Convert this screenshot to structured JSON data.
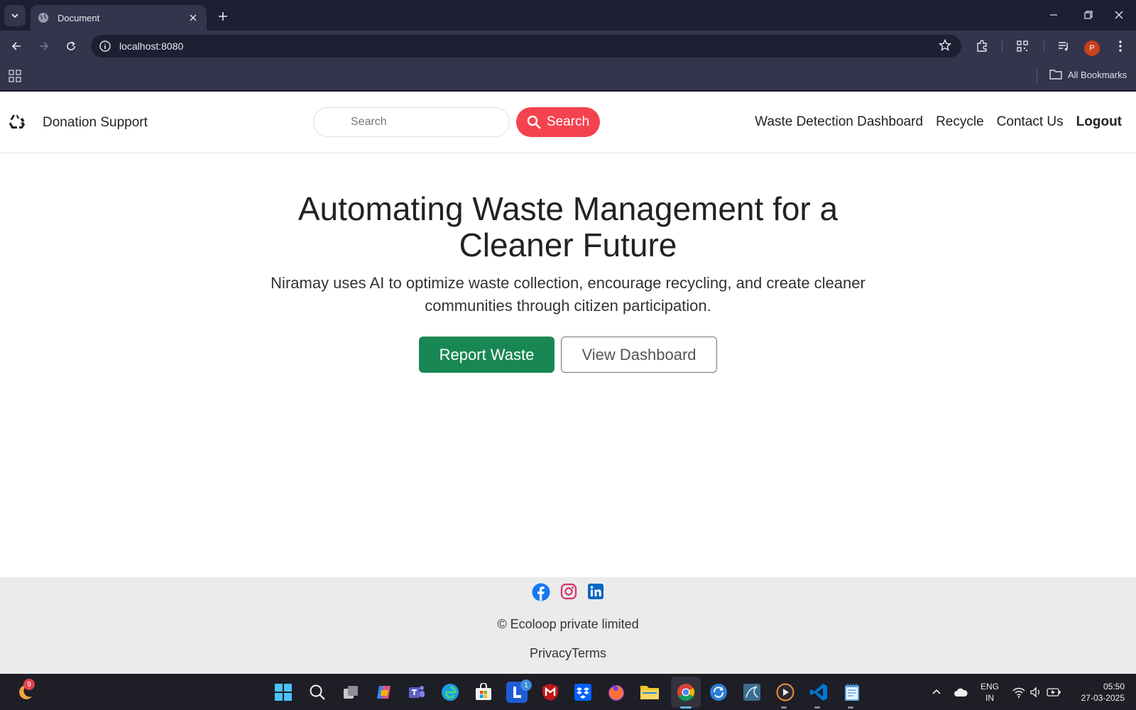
{
  "browser": {
    "tab_title": "Document",
    "url": "localhost:8080",
    "bookmarks_label": "All Bookmarks",
    "profile_initial": "P"
  },
  "site": {
    "brand": "Donation Support",
    "search_placeholder": "Search",
    "search_button": "Search",
    "nav_links": [
      "Waste Detection Dashboard",
      "Recycle",
      "Contact Us",
      "Logout"
    ]
  },
  "hero": {
    "title": "Automating Waste Management for a Cleaner Future",
    "subtitle": "Niramay uses AI to optimize waste collection, encourage recycling, and create cleaner communities through citizen participation.",
    "primary_cta": "Report Waste",
    "secondary_cta": "View Dashboard"
  },
  "footer": {
    "socials": [
      "facebook-icon",
      "instagram-icon",
      "linkedin-icon"
    ],
    "copyright": "© Ecoloop private limited",
    "legal": "PrivacyTerms"
  },
  "taskbar": {
    "weather_badge": "9",
    "outlook_badge": "1",
    "language": "ENG",
    "region": "IN",
    "time": "05:50",
    "date": "27-03-2025"
  },
  "colors": {
    "search_button": "#f5424f",
    "primary_button": "#198754",
    "chrome_dark": "#1f1f33",
    "chrome_mid": "#34344d"
  }
}
